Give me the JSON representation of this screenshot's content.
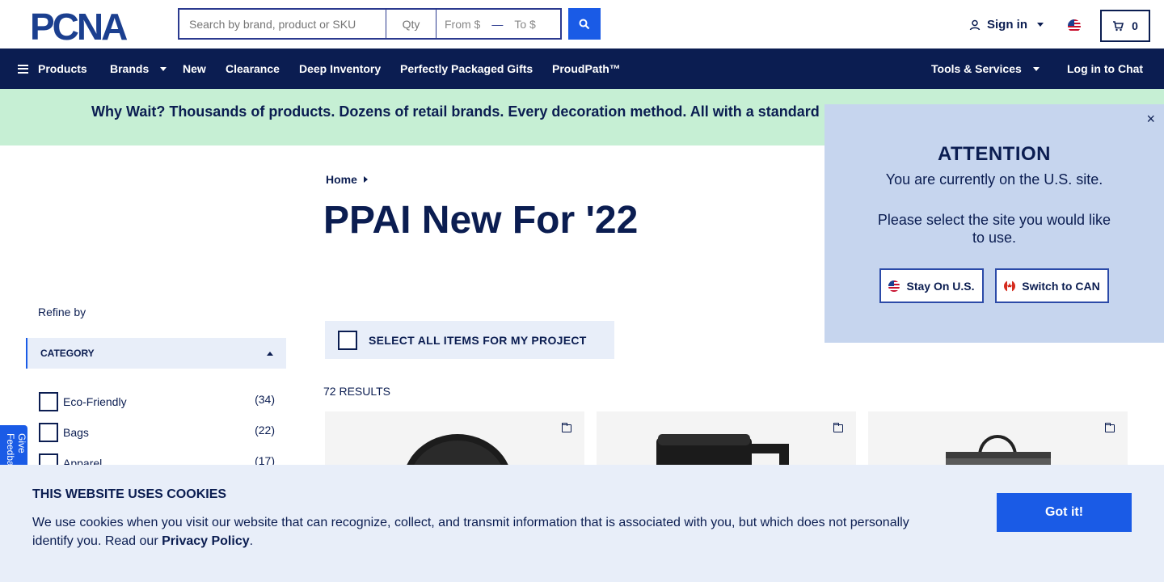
{
  "header": {
    "logo_text": "PCNA",
    "search_placeholder": "Search by brand, product or SKU",
    "qty_placeholder": "Qty",
    "price_from": "From $",
    "price_to": "To $",
    "signin_label": "Sign in",
    "cart_count": "0"
  },
  "nav": {
    "products": "Products",
    "brands": "Brands",
    "new": "New",
    "clearance": "Clearance",
    "deep_inventory": "Deep Inventory",
    "gifts": "Perfectly Packaged Gifts",
    "proudpath": "ProudPath™",
    "tools": "Tools & Services",
    "chat": "Log in to Chat"
  },
  "promo": {
    "text": "Why Wait? Thousands of products. Dozens of retail brands. Every decoration method. All with a standard"
  },
  "breadcrumb": {
    "home": "Home"
  },
  "page": {
    "title": "PPAI New For '22",
    "refine_by": "Refine by",
    "select_all": "SELECT ALL ITEMS FOR MY PROJECT",
    "results": "72 RESULTS"
  },
  "filters": {
    "category_label": "CATEGORY",
    "items": [
      {
        "label": "Eco-Friendly",
        "count": "(34)"
      },
      {
        "label": "Bags",
        "count": "(22)"
      },
      {
        "label": "Apparel",
        "count": "(17)"
      }
    ]
  },
  "feedback": {
    "label": "Give Feedback"
  },
  "attention": {
    "title": "ATTENTION",
    "line1": "You are currently on the U.S. site.",
    "line2": "Please select the site you would like to use.",
    "stay": "Stay On U.S.",
    "switch": "Switch to CAN",
    "close": "×"
  },
  "cookie": {
    "title": "THIS WEBSITE USES COOKIES",
    "text": "We use cookies when you visit our website that can recognize, collect, and transmit information that is associated with you, but which does not personally identify you. Read our",
    "link": "Privacy Policy",
    "period": ".",
    "button": "Got it!"
  },
  "colors": {
    "navy": "#0b1d51",
    "accent_blue": "#1a5be6",
    "promo_green": "#c6efd4",
    "attention_bg": "#c6d5ee",
    "light_panel": "#e8eef9"
  }
}
